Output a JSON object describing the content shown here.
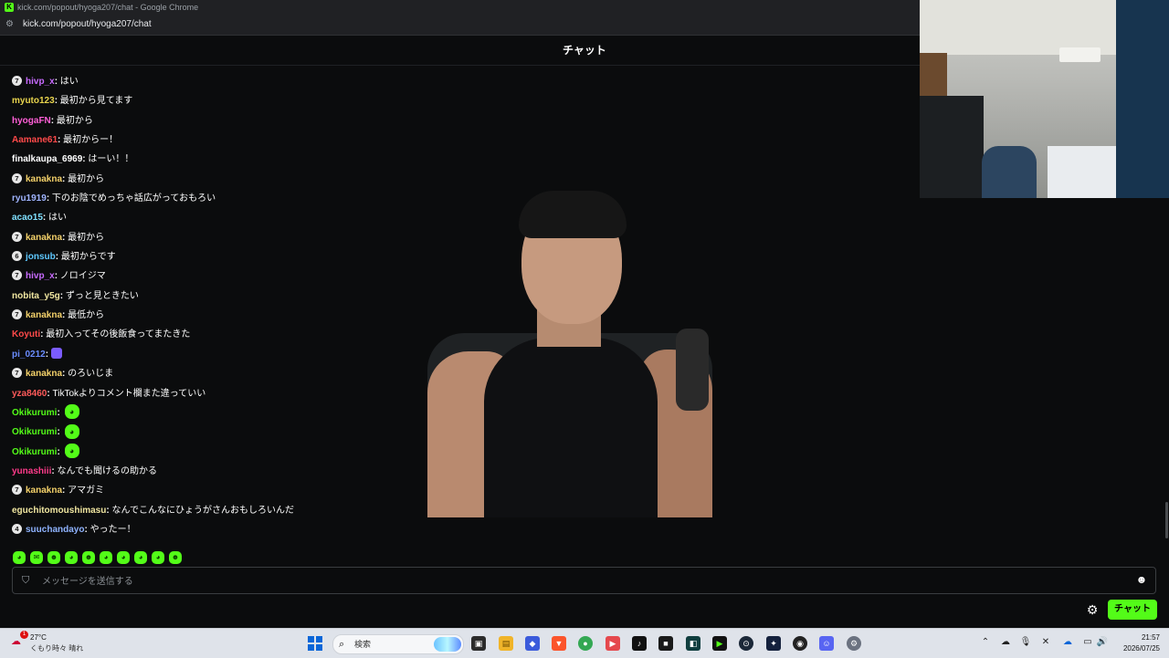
{
  "browser": {
    "window_title": "kick.com/popout/hyoga207/chat - Google Chrome",
    "url": "kick.com/popout/hyoga207/chat"
  },
  "chat": {
    "header_title": "チャット",
    "messages": [
      {
        "badge": "7",
        "user": "hivp_x",
        "color": "#c86bff",
        "text": "はい"
      },
      {
        "badge": "",
        "user": "myuto123",
        "color": "#e8d44d",
        "text": "最初から見てます"
      },
      {
        "badge": "",
        "user": "hyogaFN",
        "color": "#ff5fd7",
        "text": "最初から"
      },
      {
        "badge": "",
        "user": "Aamane61",
        "color": "#ff4a4a",
        "text": "最初からー！"
      },
      {
        "badge": "",
        "user": "finalkaupa_6969",
        "color": "#ffffff",
        "text": "はーい！！"
      },
      {
        "badge": "7",
        "user": "kanakna",
        "color": "#f5d26a",
        "text": "最初から"
      },
      {
        "badge": "",
        "user": "ryu1919",
        "color": "#9fb4ff",
        "text": "下のお陰でめっちゃ話広がっておもろい"
      },
      {
        "badge": "",
        "user": "acao15",
        "color": "#7fe0ff",
        "text": "はい"
      },
      {
        "badge": "7",
        "user": "kanakna",
        "color": "#f5d26a",
        "text": "最初から"
      },
      {
        "badge": "6",
        "user": "jonsub",
        "color": "#5ec8ff",
        "text": "最初からです"
      },
      {
        "badge": "7",
        "user": "hivp_x",
        "color": "#c86bff",
        "text": "ノロイジマ"
      },
      {
        "badge": "",
        "user": "nobita_y5g",
        "color": "#f0e6a0",
        "text": "ずっと見ときたい"
      },
      {
        "badge": "7",
        "user": "kanakna",
        "color": "#f5d26a",
        "text": "最低から"
      },
      {
        "badge": "",
        "user": "Koyuti",
        "color": "#ff4a4a",
        "text": "最初入ってその後飯食ってまたきた"
      },
      {
        "badge": "",
        "user": "pi_0212",
        "color": "#6a8cff",
        "text": ""
      },
      {
        "badge": "7",
        "user": "kanakna",
        "color": "#f5d26a",
        "text": "のろいじま"
      },
      {
        "badge": "",
        "user": "yza8460",
        "color": "#ff5a5a",
        "text": "TikTokよりコメント欄また違っていい"
      },
      {
        "badge": "",
        "user": "Okikurumi",
        "color": "#53fc18",
        "text": ""
      },
      {
        "badge": "",
        "user": "Okikurumi",
        "color": "#53fc18",
        "text": ""
      },
      {
        "badge": "",
        "user": "Okikurumi",
        "color": "#53fc18",
        "text": ""
      },
      {
        "badge": "",
        "user": "yunashiii",
        "color": "#ff3b8a",
        "text": "なんでも聞けるの助かる"
      },
      {
        "badge": "7",
        "user": "kanakna",
        "color": "#f5d26a",
        "text": "アマガミ"
      },
      {
        "badge": "",
        "user": "eguchitomoushimasu",
        "color": "#f0e6a0",
        "text": "なんでこんなにひょうがさんおもしろいんだ"
      },
      {
        "badge": "4",
        "user": "suuchandayo",
        "color": "#8fb3ff",
        "text": "やったー！"
      }
    ],
    "input_placeholder": "メッセージを送信する",
    "send_label": "チャット"
  },
  "taskbar": {
    "temperature": "27°C",
    "weather": "くもり時々 晴れ",
    "weather_badge": "1",
    "search_label": "検索",
    "time": "21:57",
    "date": "2026/07/25"
  },
  "colors": {
    "accent": "#53fc18",
    "background": "#0b0c0d"
  }
}
